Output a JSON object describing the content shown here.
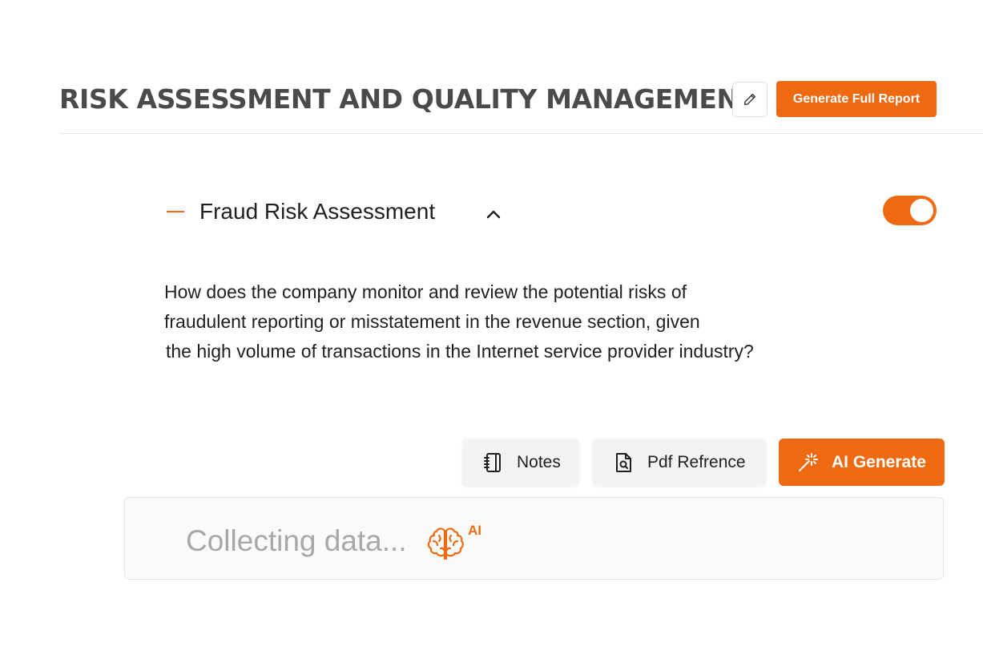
{
  "header": {
    "title": "RISK ASSESSMENT AND QUALITY MANAGEMENT",
    "edit_icon": "pencil-icon",
    "report_button_label": "Generate Full Report"
  },
  "section": {
    "title": "Fraud Risk Assessment",
    "collapse_icon": "minus-icon",
    "chevron_icon": "chevron-up-icon",
    "enabled": true
  },
  "question": {
    "lines": [
      "How does the company monitor and review the potential risks of",
      "fraudulent reporting or misstatement in the revenue section, given",
      "the high volume of transactions in the Internet service provider industry?"
    ]
  },
  "actions": {
    "notes_label": "Notes",
    "notes_icon": "notebook-icon",
    "pdf_label": "Pdf Refrence",
    "pdf_icon": "file-search-icon",
    "ai_label": "AI Generate",
    "ai_icon": "magic-wand-icon"
  },
  "output": {
    "status_text": "Collecting data...",
    "status_icon": "brain-icon",
    "badge": "AI"
  },
  "colors": {
    "accent": "#ee6a12",
    "title": "#4a4a4a",
    "muted_text": "#a8a8a8"
  }
}
